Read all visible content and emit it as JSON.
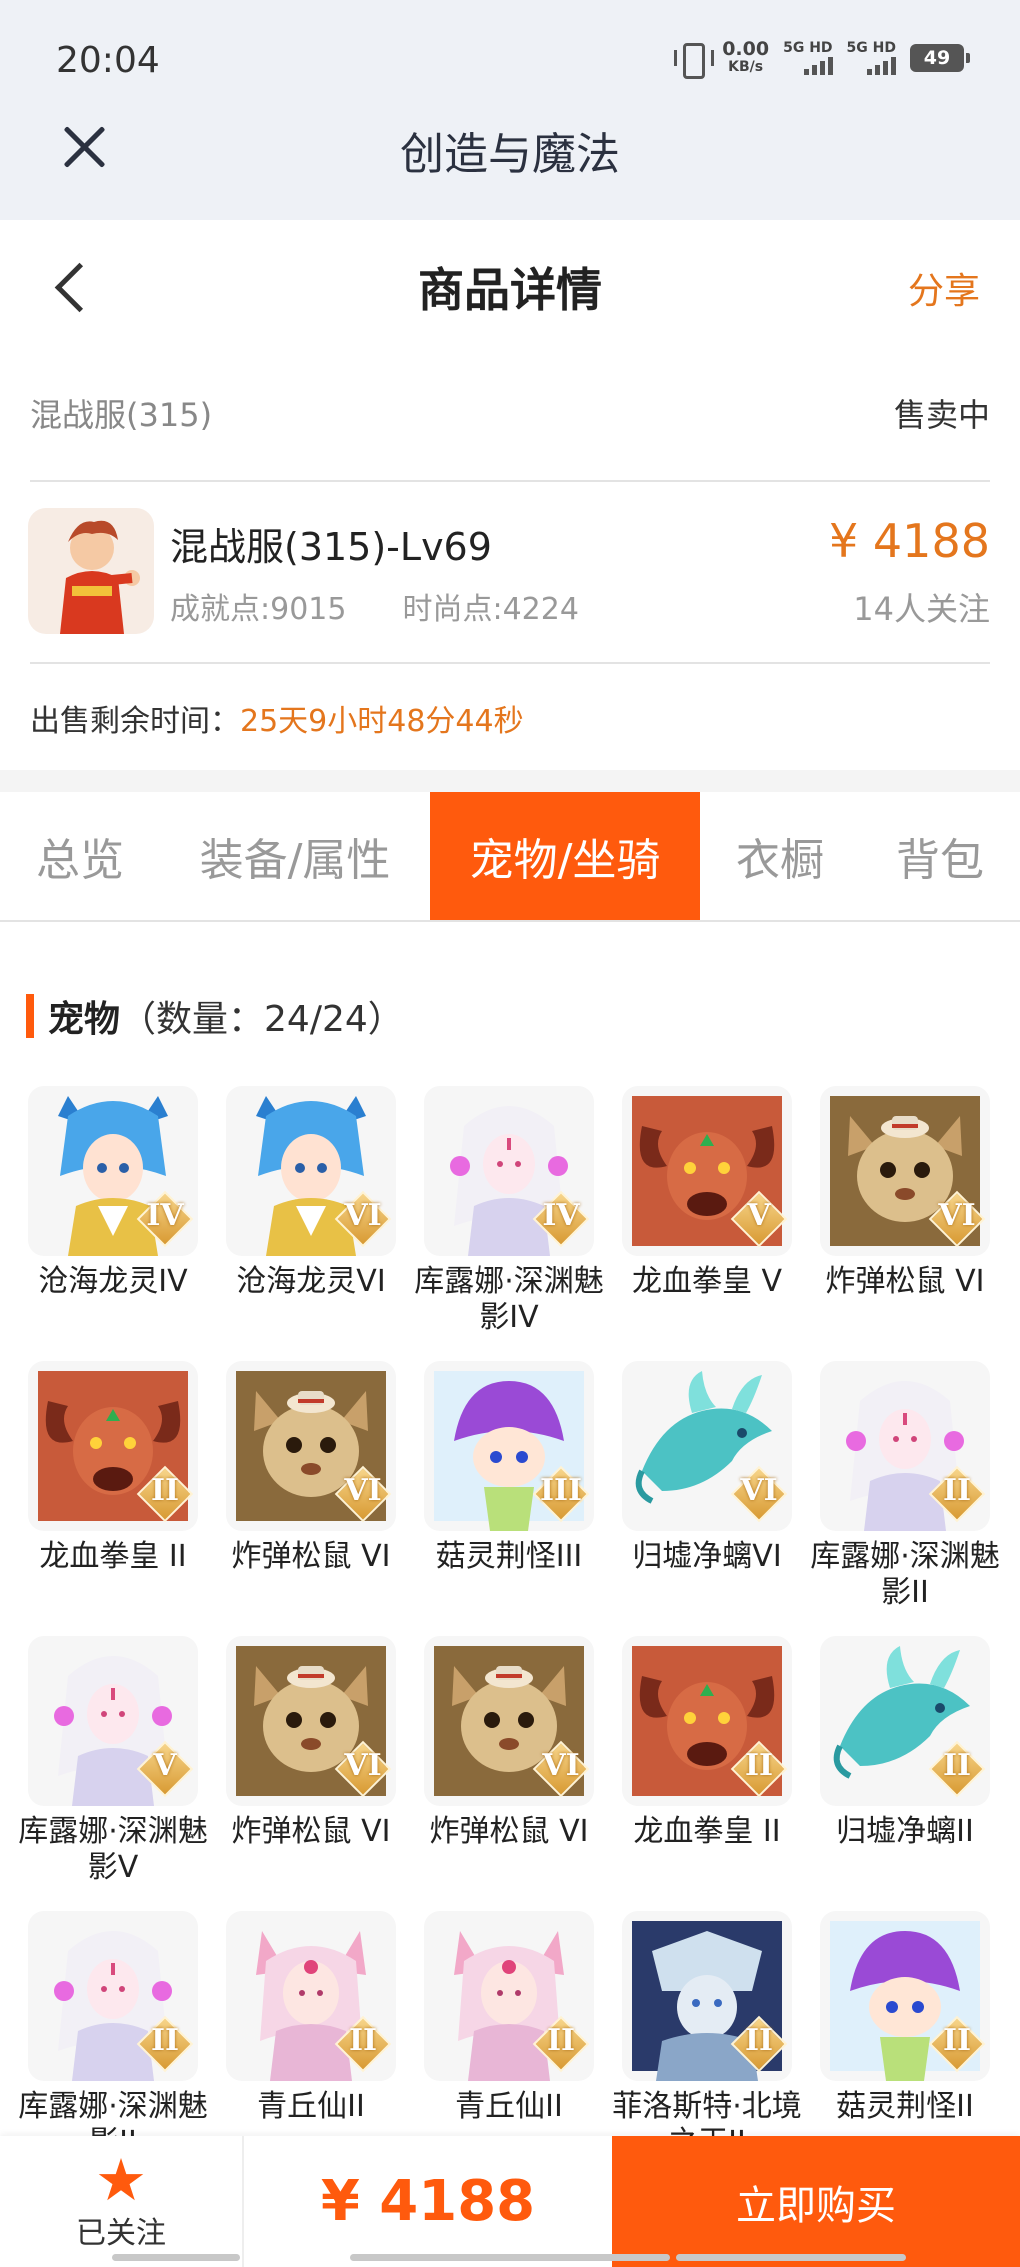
{
  "status_bar": {
    "time": "20:04",
    "net_speed_value": "0.00",
    "net_speed_unit": "KB/s",
    "sim1": "5G HD",
    "sim2": "5G HD",
    "battery": "49"
  },
  "webview": {
    "title": "创造与魔法"
  },
  "header": {
    "title": "商品详情",
    "share_label": "分享"
  },
  "product": {
    "server": "混战服(315)",
    "status": "售卖中",
    "name": "混战服(315)-Lv69",
    "achievement": "成就点:9015",
    "fashion": "时尚点:4224",
    "price": "¥ 4188",
    "followers": "14人关注",
    "remaining_label": "出售剩余时间：",
    "remaining_value": "25天9小时48分44秒"
  },
  "tabs": [
    {
      "label": "总览"
    },
    {
      "label": "装备/属性"
    },
    {
      "label": "宠物/坐骑",
      "active": true
    },
    {
      "label": "衣橱"
    },
    {
      "label": "背包"
    }
  ],
  "pets_section": {
    "title": "宠物",
    "count": "（数量：24/24）"
  },
  "pets": [
    {
      "name": "沧海龙灵IV",
      "rank": "IV",
      "icon": "blue-dragon"
    },
    {
      "name": "沧海龙灵VI",
      "rank": "VI",
      "icon": "blue-dragon"
    },
    {
      "name": "库露娜·深渊魅影IV",
      "rank": "IV",
      "icon": "white-fairy"
    },
    {
      "name": "龙血拳皇 V",
      "rank": "V",
      "icon": "red-ram"
    },
    {
      "name": "炸弹松鼠 VI",
      "rank": "VI",
      "icon": "squirrel"
    },
    {
      "name": "龙血拳皇 II",
      "rank": "II",
      "icon": "red-ram"
    },
    {
      "name": "炸弹松鼠 VI",
      "rank": "VI",
      "icon": "squirrel"
    },
    {
      "name": "菇灵荆怪III",
      "rank": "III",
      "icon": "purple-mushroom"
    },
    {
      "name": "归墟净螭VI",
      "rank": "VI",
      "icon": "teal-dragon"
    },
    {
      "name": "库露娜·深渊魅影II",
      "rank": "II",
      "icon": "white-fairy"
    },
    {
      "name": "库露娜·深渊魅影V",
      "rank": "V",
      "icon": "white-fairy"
    },
    {
      "name": "炸弹松鼠 VI",
      "rank": "VI",
      "icon": "squirrel"
    },
    {
      "name": "炸弹松鼠 VI",
      "rank": "VI",
      "icon": "squirrel"
    },
    {
      "name": "龙血拳皇 II",
      "rank": "II",
      "icon": "red-ram"
    },
    {
      "name": "归墟净螭II",
      "rank": "II",
      "icon": "teal-dragon"
    },
    {
      "name": "库露娜·深渊魅影II",
      "rank": "II",
      "icon": "white-fairy"
    },
    {
      "name": "青丘仙II",
      "rank": "II",
      "icon": "fox-fairy"
    },
    {
      "name": "青丘仙II",
      "rank": "II",
      "icon": "fox-fairy"
    },
    {
      "name": "菲洛斯特·北境之王II",
      "rank": "II",
      "icon": "frost-king"
    },
    {
      "name": "菇灵荆怪II",
      "rank": "II",
      "icon": "purple-mushroom"
    }
  ],
  "bottom_bar": {
    "follow_label": "已关注",
    "price": "¥ 4188",
    "buy_label": "立即购买"
  },
  "colors": {
    "accent": "#ff5a0d",
    "price": "#e4761d"
  }
}
